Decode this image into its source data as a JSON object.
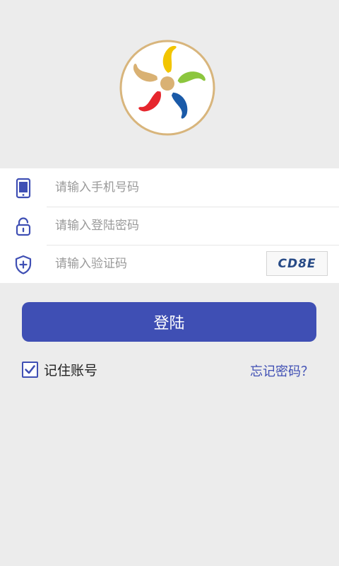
{
  "logo": {
    "icon": "pinwheel-logo",
    "colors": [
      "#f2c500",
      "#8cc63e",
      "#1a5aa8",
      "#e6262d",
      "#d9b173"
    ]
  },
  "form": {
    "phone": {
      "placeholder": "请输入手机号码",
      "icon": "mobile-phone-icon"
    },
    "password": {
      "placeholder": "请输入登陆密码",
      "icon": "lock-icon"
    },
    "captcha": {
      "placeholder": "请输入验证码",
      "icon": "shield-plus-icon",
      "code": "CD8E"
    }
  },
  "login_button": "登陆",
  "remember": {
    "label": "记住账号",
    "checked": true
  },
  "forgot_link": "忘记密码？",
  "colors": {
    "accent": "#3f4fb4",
    "background": "#ececec"
  }
}
